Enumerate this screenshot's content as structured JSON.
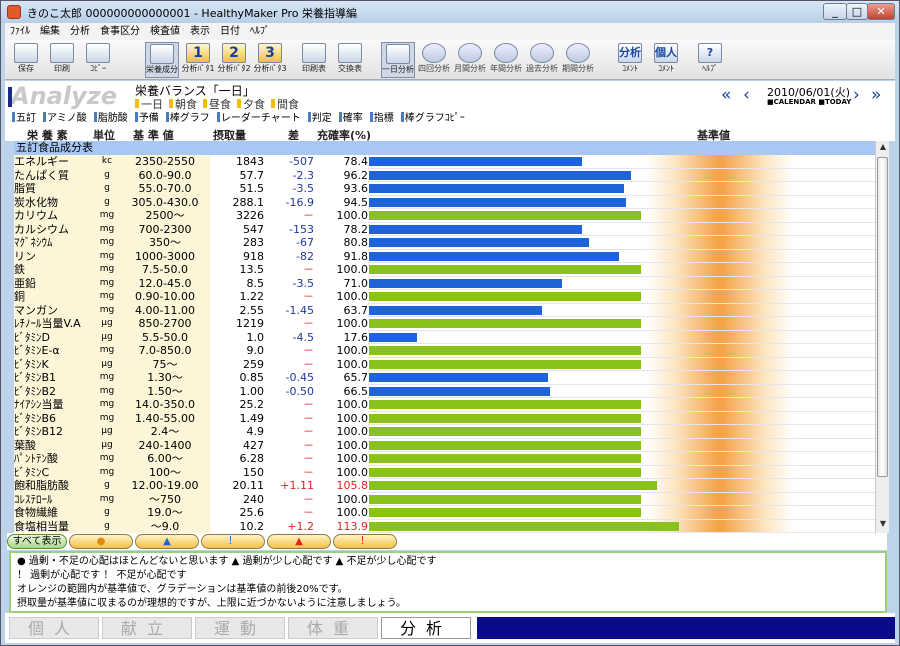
{
  "window": {
    "title": "きのこ太郎 000000000000001 - HealthyMaker Pro 栄養指導編"
  },
  "menu": [
    "ﾌｧｲﾙ",
    "編集",
    "分析",
    "食事区分",
    "検査値",
    "表示",
    "日付",
    "ﾍﾙﾌﾟ"
  ],
  "toolbar": [
    {
      "label": "保存",
      "icon": "save-icon"
    },
    {
      "label": "印刷",
      "icon": "print-icon"
    },
    {
      "label": "ｺﾋﾟｰ",
      "icon": "copy-icon"
    },
    {
      "label": "栄養成分",
      "icon": "nutrition-icon",
      "selected": true
    },
    {
      "label": "分析ﾊﾟﾀ1",
      "icon": "1"
    },
    {
      "label": "分析ﾊﾟﾀ2",
      "icon": "2"
    },
    {
      "label": "分析ﾊﾟﾀ3",
      "icon": "3"
    },
    {
      "label": "印刷表",
      "icon": "chart-icon"
    },
    {
      "label": "交換表",
      "icon": "exchange-icon"
    },
    {
      "label": "一日分析",
      "icon": "day-icon",
      "selected": true
    },
    {
      "label": "四回分析",
      "icon": "dim-icon"
    },
    {
      "label": "月間分析",
      "icon": "dim-icon"
    },
    {
      "label": "年間分析",
      "icon": "dim-icon"
    },
    {
      "label": "過去分析",
      "icon": "dim-icon"
    },
    {
      "label": "期間分析",
      "icon": "dim-icon"
    },
    {
      "label": "ｺﾒﾝﾄ",
      "icon": "分析"
    },
    {
      "label": "ｺﾒﾝﾄ",
      "icon": "個人"
    },
    {
      "label": "ﾍﾙﾌﾟ",
      "icon": "?"
    }
  ],
  "header": {
    "logo": "Analyze",
    "title": "栄養バランス「一日」",
    "periods": [
      "一日",
      "朝食",
      "昼食",
      "夕食",
      "間食"
    ],
    "date": "2010/06/01(火)",
    "date_sub": "■CALENDAR ■TODAY"
  },
  "options": [
    "五訂",
    "アミノ酸",
    "脂肪酸",
    "予備",
    "棒グラフ",
    "レーダーチャート",
    "判定",
    "確率",
    "指標",
    "棒グラフｺﾋﾟｰ"
  ],
  "columns": {
    "name": "栄 養 素",
    "unit": "単位",
    "std": "基 準 値",
    "intake": "摂取量",
    "diff": "差",
    "rate": "充確率(%)",
    "ref": "基準値"
  },
  "section": "五訂食品成分表",
  "rows": [
    {
      "name": "エネルギー",
      "unit": "kc",
      "std": "2350-2550",
      "intake": "1843",
      "diff": "-507",
      "rate": "78.4",
      "value": 78.4
    },
    {
      "name": "たんぱく質",
      "unit": "g",
      "std": "60.0-90.0",
      "intake": "57.7",
      "diff": "-2.3",
      "rate": "96.2",
      "value": 96.2
    },
    {
      "name": "脂質",
      "unit": "g",
      "std": "55.0-70.0",
      "intake": "51.5",
      "diff": "-3.5",
      "rate": "93.6",
      "value": 93.6
    },
    {
      "name": "炭水化物",
      "unit": "g",
      "std": "305.0-430.0",
      "intake": "288.1",
      "diff": "-16.9",
      "rate": "94.5",
      "value": 94.5
    },
    {
      "name": "カリウム",
      "unit": "mg",
      "std": "2500～",
      "intake": "3226",
      "diff": "－",
      "rate": "100.0",
      "value": 100.0
    },
    {
      "name": "カルシウム",
      "unit": "mg",
      "std": "700-2300",
      "intake": "547",
      "diff": "-153",
      "rate": "78.2",
      "value": 78.2
    },
    {
      "name": "ﾏｸﾞﾈｼｳﾑ",
      "unit": "mg",
      "std": "350～",
      "intake": "283",
      "diff": "-67",
      "rate": "80.8",
      "value": 80.8
    },
    {
      "name": "リン",
      "unit": "mg",
      "std": "1000-3000",
      "intake": "918",
      "diff": "-82",
      "rate": "91.8",
      "value": 91.8
    },
    {
      "name": "鉄",
      "unit": "mg",
      "std": "7.5-50.0",
      "intake": "13.5",
      "diff": "－",
      "rate": "100.0",
      "value": 100.0
    },
    {
      "name": "亜鉛",
      "unit": "mg",
      "std": "12.0-45.0",
      "intake": "8.5",
      "diff": "-3.5",
      "rate": "71.0",
      "value": 71.0
    },
    {
      "name": "銅",
      "unit": "mg",
      "std": "0.90-10.00",
      "intake": "1.22",
      "diff": "－",
      "rate": "100.0",
      "value": 100.0
    },
    {
      "name": "マンガン",
      "unit": "mg",
      "std": "4.00-11.00",
      "intake": "2.55",
      "diff": "-1.45",
      "rate": "63.7",
      "value": 63.7
    },
    {
      "name": "ﾚﾁﾉｰﾙ当量V.A",
      "unit": "μg",
      "std": "850-2700",
      "intake": "1219",
      "diff": "－",
      "rate": "100.0",
      "value": 100.0
    },
    {
      "name": "ﾋﾞﾀﾐﾝD",
      "unit": "μg",
      "std": "5.5-50.0",
      "intake": "1.0",
      "diff": "-4.5",
      "rate": "17.6",
      "value": 17.6
    },
    {
      "name": "ﾋﾞﾀﾐﾝE-α",
      "unit": "mg",
      "std": "7.0-850.0",
      "intake": "9.0",
      "diff": "－",
      "rate": "100.0",
      "value": 100.0
    },
    {
      "name": "ﾋﾞﾀﾐﾝK",
      "unit": "μg",
      "std": "75～",
      "intake": "259",
      "diff": "－",
      "rate": "100.0",
      "value": 100.0
    },
    {
      "name": "ﾋﾞﾀﾐﾝB1",
      "unit": "mg",
      "std": "1.30～",
      "intake": "0.85",
      "diff": "-0.45",
      "rate": "65.7",
      "value": 65.7
    },
    {
      "name": "ﾋﾞﾀﾐﾝB2",
      "unit": "mg",
      "std": "1.50～",
      "intake": "1.00",
      "diff": "-0.50",
      "rate": "66.5",
      "value": 66.5
    },
    {
      "name": "ﾅｲｱｼﾝ当量",
      "unit": "mg",
      "std": "14.0-350.0",
      "intake": "25.2",
      "diff": "－",
      "rate": "100.0",
      "value": 100.0
    },
    {
      "name": "ﾋﾞﾀﾐﾝB6",
      "unit": "mg",
      "std": "1.40-55.00",
      "intake": "1.49",
      "diff": "－",
      "rate": "100.0",
      "value": 100.0
    },
    {
      "name": "ﾋﾞﾀﾐﾝB12",
      "unit": "μg",
      "std": "2.4～",
      "intake": "4.9",
      "diff": "－",
      "rate": "100.0",
      "value": 100.0
    },
    {
      "name": "葉酸",
      "unit": "μg",
      "std": "240-1400",
      "intake": "427",
      "diff": "－",
      "rate": "100.0",
      "value": 100.0
    },
    {
      "name": "ﾊﾟﾝﾄﾃﾝ酸",
      "unit": "mg",
      "std": "6.00～",
      "intake": "6.28",
      "diff": "－",
      "rate": "100.0",
      "value": 100.0
    },
    {
      "name": "ﾋﾞﾀﾐﾝC",
      "unit": "mg",
      "std": "100～",
      "intake": "150",
      "diff": "－",
      "rate": "100.0",
      "value": 100.0
    },
    {
      "name": "飽和脂肪酸",
      "unit": "g",
      "std": "12.00-19.00",
      "intake": "20.11",
      "diff": "+1.11",
      "rate": "105.8",
      "value": 105.8
    },
    {
      "name": "ｺﾚｽﾃﾛｰﾙ",
      "unit": "mg",
      "std": "～750",
      "intake": "240",
      "diff": "－",
      "rate": "100.0",
      "value": 100.0
    },
    {
      "name": "食物繊維",
      "unit": "g",
      "std": "19.0～",
      "intake": "25.6",
      "diff": "－",
      "rate": "100.0",
      "value": 100.0
    },
    {
      "name": "食塩相当量",
      "unit": "g",
      "std": "～9.0",
      "intake": "10.2",
      "diff": "+1.2",
      "rate": "113.9",
      "value": 113.9
    }
  ],
  "filters": [
    "すべて表示",
    "●",
    "▲",
    "！",
    "▲",
    "！"
  ],
  "legend": [
    "● 過剰・不足の心配はほとんどないと思います  ▲ 過剰が少し心配です  ▲ 不足が少し心配です",
    "！ 過剰が心配です  ！ 不足が心配です",
    "オレンジの範囲内が基準値で、グラデーションは基準値の前後20%です。",
    "摂取量が基準値に収まるのが理想的ですが、上限に近づかないように注意しましょう。"
  ],
  "tabs": [
    "個人",
    "献立",
    "運動",
    "体重",
    "分析"
  ],
  "colors": {
    "under": "#1f63d8",
    "ok": "#8ac21c",
    "over": "#8ac21c",
    "band": "#f3a44a"
  }
}
